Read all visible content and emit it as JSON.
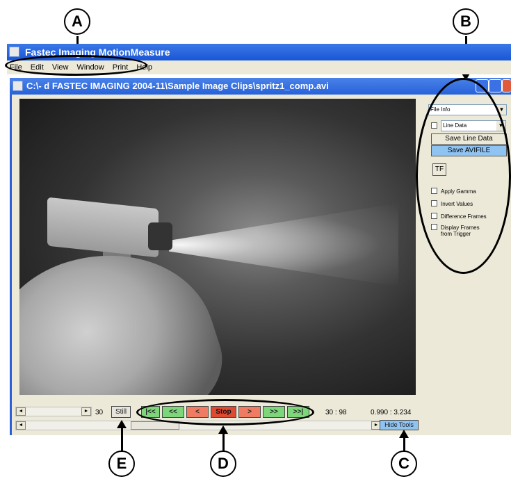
{
  "callouts": {
    "a": "A",
    "b": "B",
    "c": "C",
    "d": "D",
    "e": "E"
  },
  "app": {
    "title": "Fastec Imaging MotionMeasure"
  },
  "menu": [
    "File",
    "Edit",
    "View",
    "Window",
    "Print",
    "Help"
  ],
  "document": {
    "title": "C:\\- d FASTEC IMAGING 2004-11\\Sample Image Clips\\spritz1_comp.avi"
  },
  "panel": {
    "file_dropdown": "File Info",
    "line_dropdown": "Line Data",
    "save_line_label": "Save Line Data",
    "save_avi_label": "Save AVIFILE",
    "tf_label": "TF",
    "options": [
      "Apply Gamma",
      "Invert Values",
      "Difference Frames",
      "Display Frames from Trigger"
    ]
  },
  "transport": {
    "frame_value": "30",
    "still_label": "Still",
    "buttons": [
      "|<<",
      "<<",
      "<",
      "Stop",
      ">",
      ">>",
      ">>|"
    ],
    "frame_counter": "30 : 98",
    "time_readout": "0.990 : 3.234",
    "hide_tools_label": "Hide Tools"
  },
  "colors": {
    "titlebar": "#1a56d6",
    "green_button": "#7dd67a",
    "red_button": "#f07b63",
    "stop_button": "#e04a30",
    "highlight_button": "#8fc3f2"
  }
}
